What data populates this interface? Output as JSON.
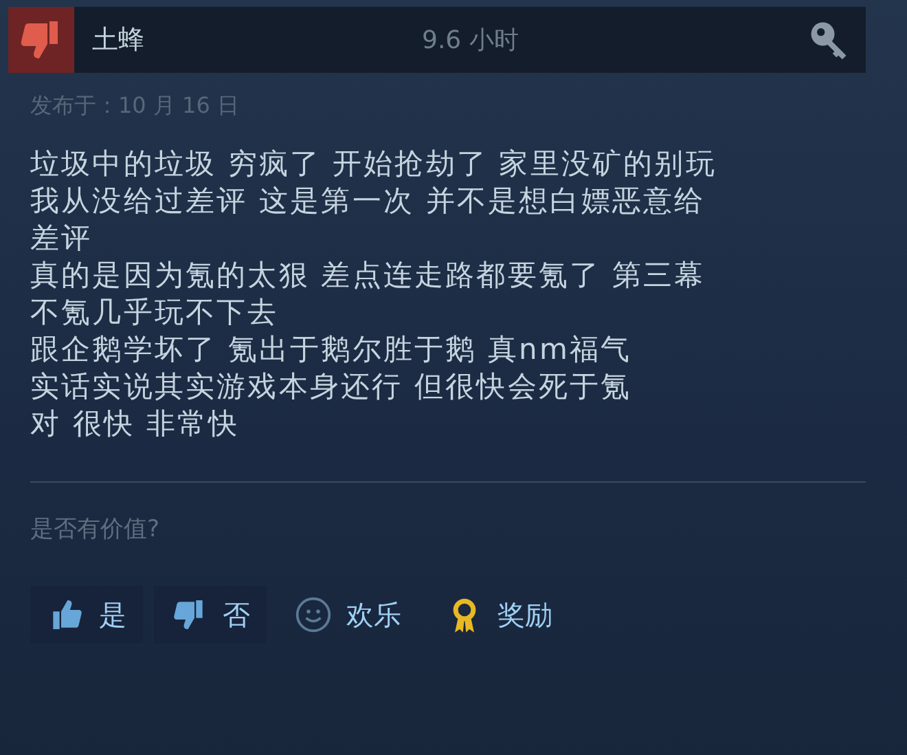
{
  "review": {
    "recommended": false,
    "author": "土蜂",
    "playtime": "9.6 小时",
    "posted": "发布于：10 月 16 日",
    "lines": [
      "垃圾中的垃圾 穷疯了 开始抢劫了 家里没矿的别玩",
      "我从没给过差评 这是第一次 并不是想白嫖恶意给",
      "差评",
      "真的是因为氪的太狠 差点连走路都要氪了 第三幕",
      "不氪几乎玩不下去",
      "跟企鹅学坏了 氪出于鹅尔胜于鹅 真nm福气",
      "实话实说其实游戏本身还行 但很快会死于氪",
      "对 很快 非常快"
    ]
  },
  "helpful": {
    "prompt": "是否有价值?",
    "buttons": [
      {
        "kind": "yes",
        "label": "是"
      },
      {
        "kind": "no",
        "label": "否"
      },
      {
        "kind": "funny",
        "label": "欢乐"
      },
      {
        "kind": "award",
        "label": "奖励"
      }
    ]
  }
}
